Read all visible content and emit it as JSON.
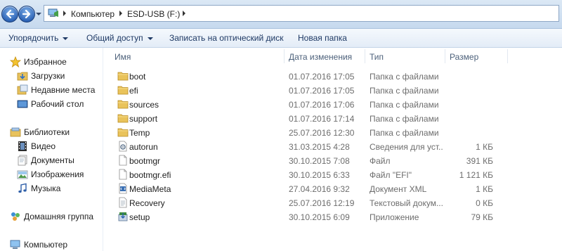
{
  "address": {
    "crumbs": [
      "Компьютер",
      "ESD-USB (F:)"
    ]
  },
  "toolbar": {
    "organize": "Упорядочить",
    "share": "Общий доступ",
    "burn": "Записать на оптический диск",
    "new_folder": "Новая папка"
  },
  "nav": {
    "favorites": "Избранное",
    "downloads": "Загрузки",
    "recent": "Недавние места",
    "desktop": "Рабочий стол",
    "libraries": "Библиотеки",
    "video": "Видео",
    "documents": "Документы",
    "pictures": "Изображения",
    "music": "Музыка",
    "homegroup": "Домашняя группа",
    "computer": "Компьютер"
  },
  "columns": {
    "name": "Имя",
    "date": "Дата изменения",
    "type": "Тип",
    "size": "Размер"
  },
  "files": [
    {
      "icon": "folder-icon",
      "name": "boot",
      "date": "01.07.2016 17:05",
      "type": "Папка с файлами",
      "size": ""
    },
    {
      "icon": "folder-icon",
      "name": "efi",
      "date": "01.07.2016 17:05",
      "type": "Папка с файлами",
      "size": ""
    },
    {
      "icon": "folder-icon",
      "name": "sources",
      "date": "01.07.2016 17:06",
      "type": "Папка с файлами",
      "size": ""
    },
    {
      "icon": "folder-icon",
      "name": "support",
      "date": "01.07.2016 17:14",
      "type": "Папка с файлами",
      "size": ""
    },
    {
      "icon": "folder-icon",
      "name": "Temp",
      "date": "25.07.2016 12:30",
      "type": "Папка с файлами",
      "size": ""
    },
    {
      "icon": "settings-file-icon",
      "name": "autorun",
      "date": "31.03.2015 4:28",
      "type": "Сведения для уст...",
      "size": "1 КБ"
    },
    {
      "icon": "file-icon",
      "name": "bootmgr",
      "date": "30.10.2015 7:08",
      "type": "Файл",
      "size": "391 КБ"
    },
    {
      "icon": "file-icon",
      "name": "bootmgr.efi",
      "date": "30.10.2015 6:33",
      "type": "Файл \"EFI\"",
      "size": "1 121 КБ"
    },
    {
      "icon": "xml-file-icon",
      "name": "MediaMeta",
      "date": "27.04.2016 9:32",
      "type": "Документ XML",
      "size": "1 КБ"
    },
    {
      "icon": "text-file-icon",
      "name": "Recovery",
      "date": "25.07.2016 12:19",
      "type": "Текстовый докум...",
      "size": "0 КБ"
    },
    {
      "icon": "setup-icon",
      "name": "setup",
      "date": "30.10.2015 6:09",
      "type": "Приложение",
      "size": "79 КБ"
    }
  ]
}
